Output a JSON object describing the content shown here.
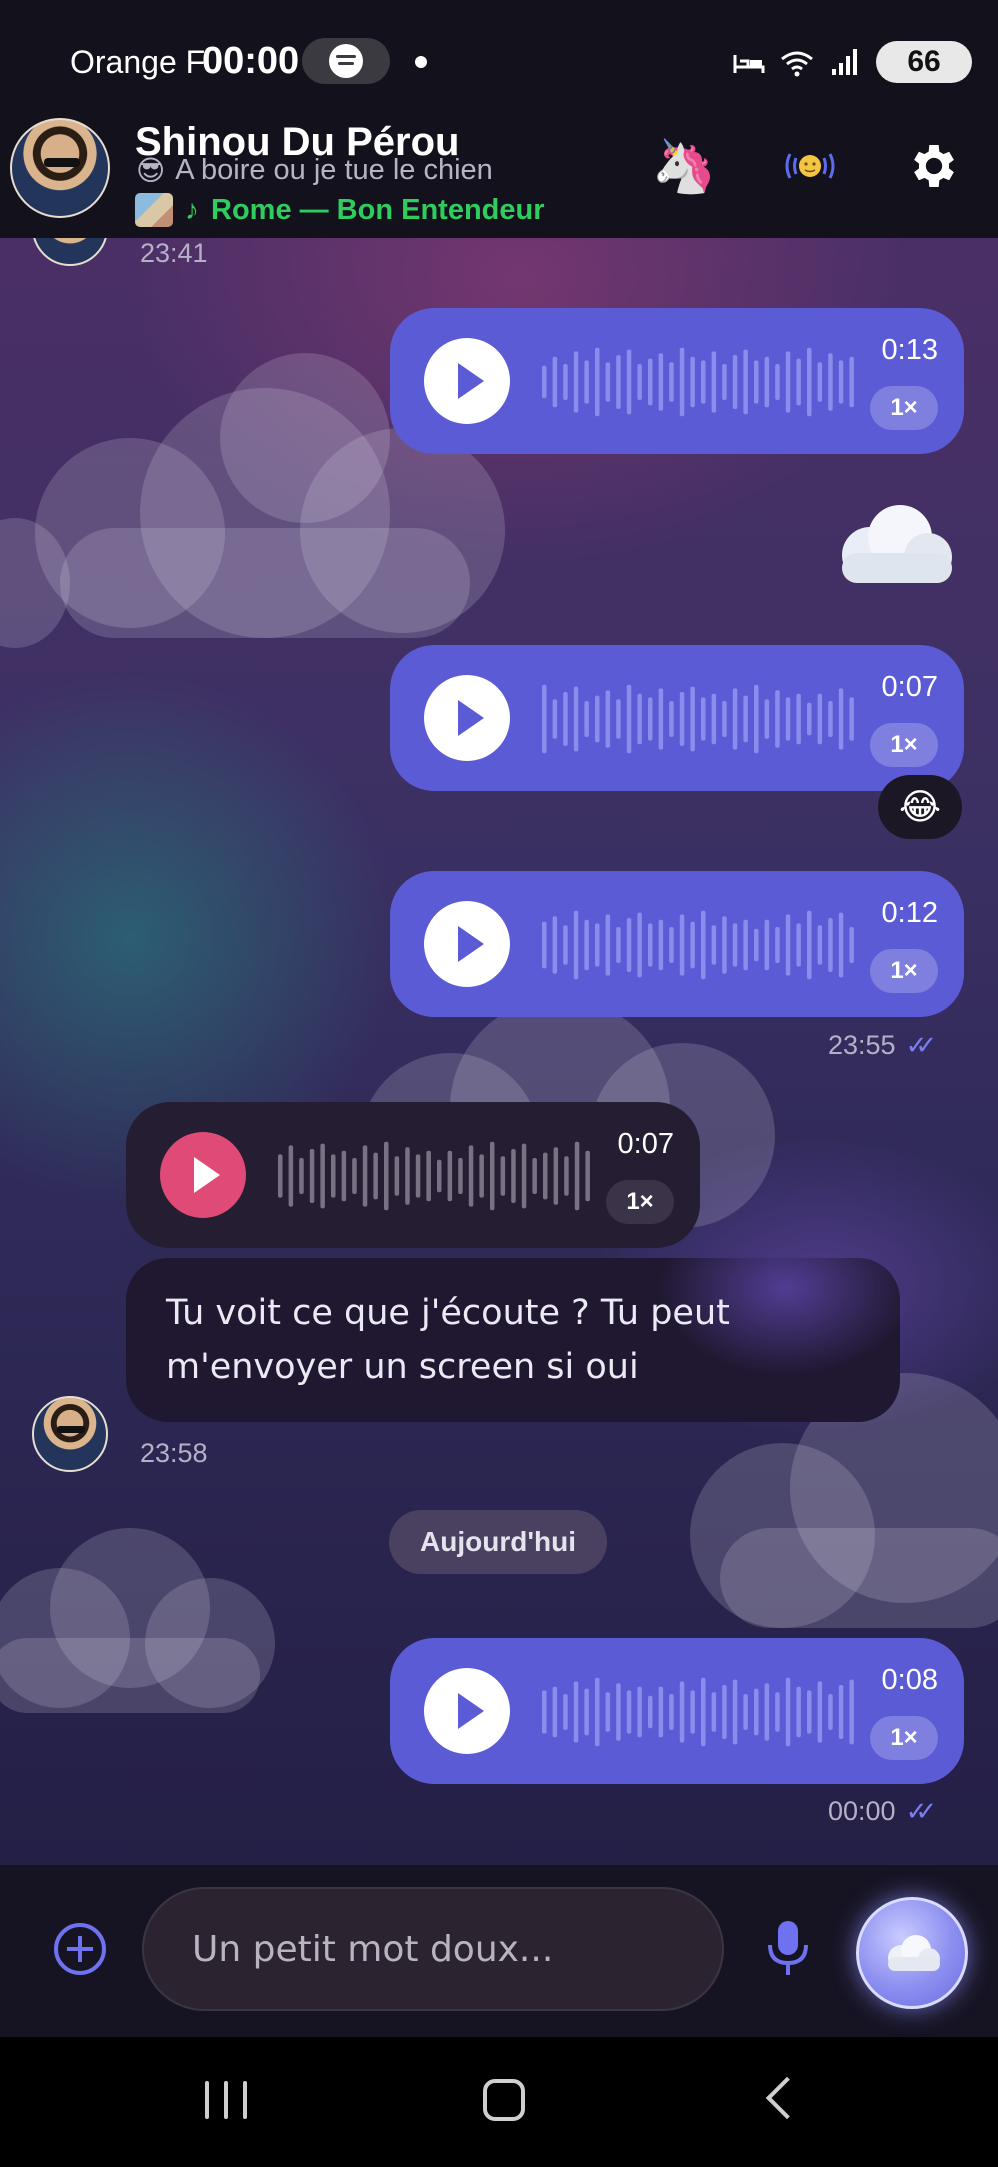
{
  "status_bar": {
    "carrier": "Orange F",
    "time": "00:00",
    "battery": "66",
    "icons": [
      "spotify-icon",
      "sleep-icon",
      "wifi-icon",
      "signal-icon",
      "battery-icon"
    ]
  },
  "header": {
    "name": "Shinou Du Pérou",
    "status_emoji": "😎",
    "status_text": "A boire ou je tue le chien",
    "song": "Rome — Bon Entendeur",
    "icons": {
      "unicorn": "🦄",
      "wave": "🙂",
      "settings": "gear-icon"
    }
  },
  "messages": {
    "first_time": "23:41",
    "v1": {
      "duration": "0:13",
      "speed": "1×"
    },
    "v2": {
      "duration": "0:07",
      "speed": "1×",
      "reaction": "😂"
    },
    "v3": {
      "duration": "0:12",
      "speed": "1×",
      "time": "23:55"
    },
    "v4": {
      "duration": "0:07",
      "speed": "1×"
    },
    "text": "Tu voit ce que j'écoute ? Tu peut m'envoyer un screen si oui",
    "text_time": "23:58",
    "day_separator": "Aujourd'hui",
    "v5": {
      "duration": "0:08",
      "speed": "1×",
      "time": "00:00"
    }
  },
  "composer": {
    "placeholder": "Un petit mot doux..."
  },
  "colors": {
    "outgoing_bubble": "#5c5bd6",
    "incoming_bubble": "#251d31",
    "incoming_play": "#e04a76",
    "song_green": "#2fcc5e",
    "accent": "#6f72f0"
  }
}
